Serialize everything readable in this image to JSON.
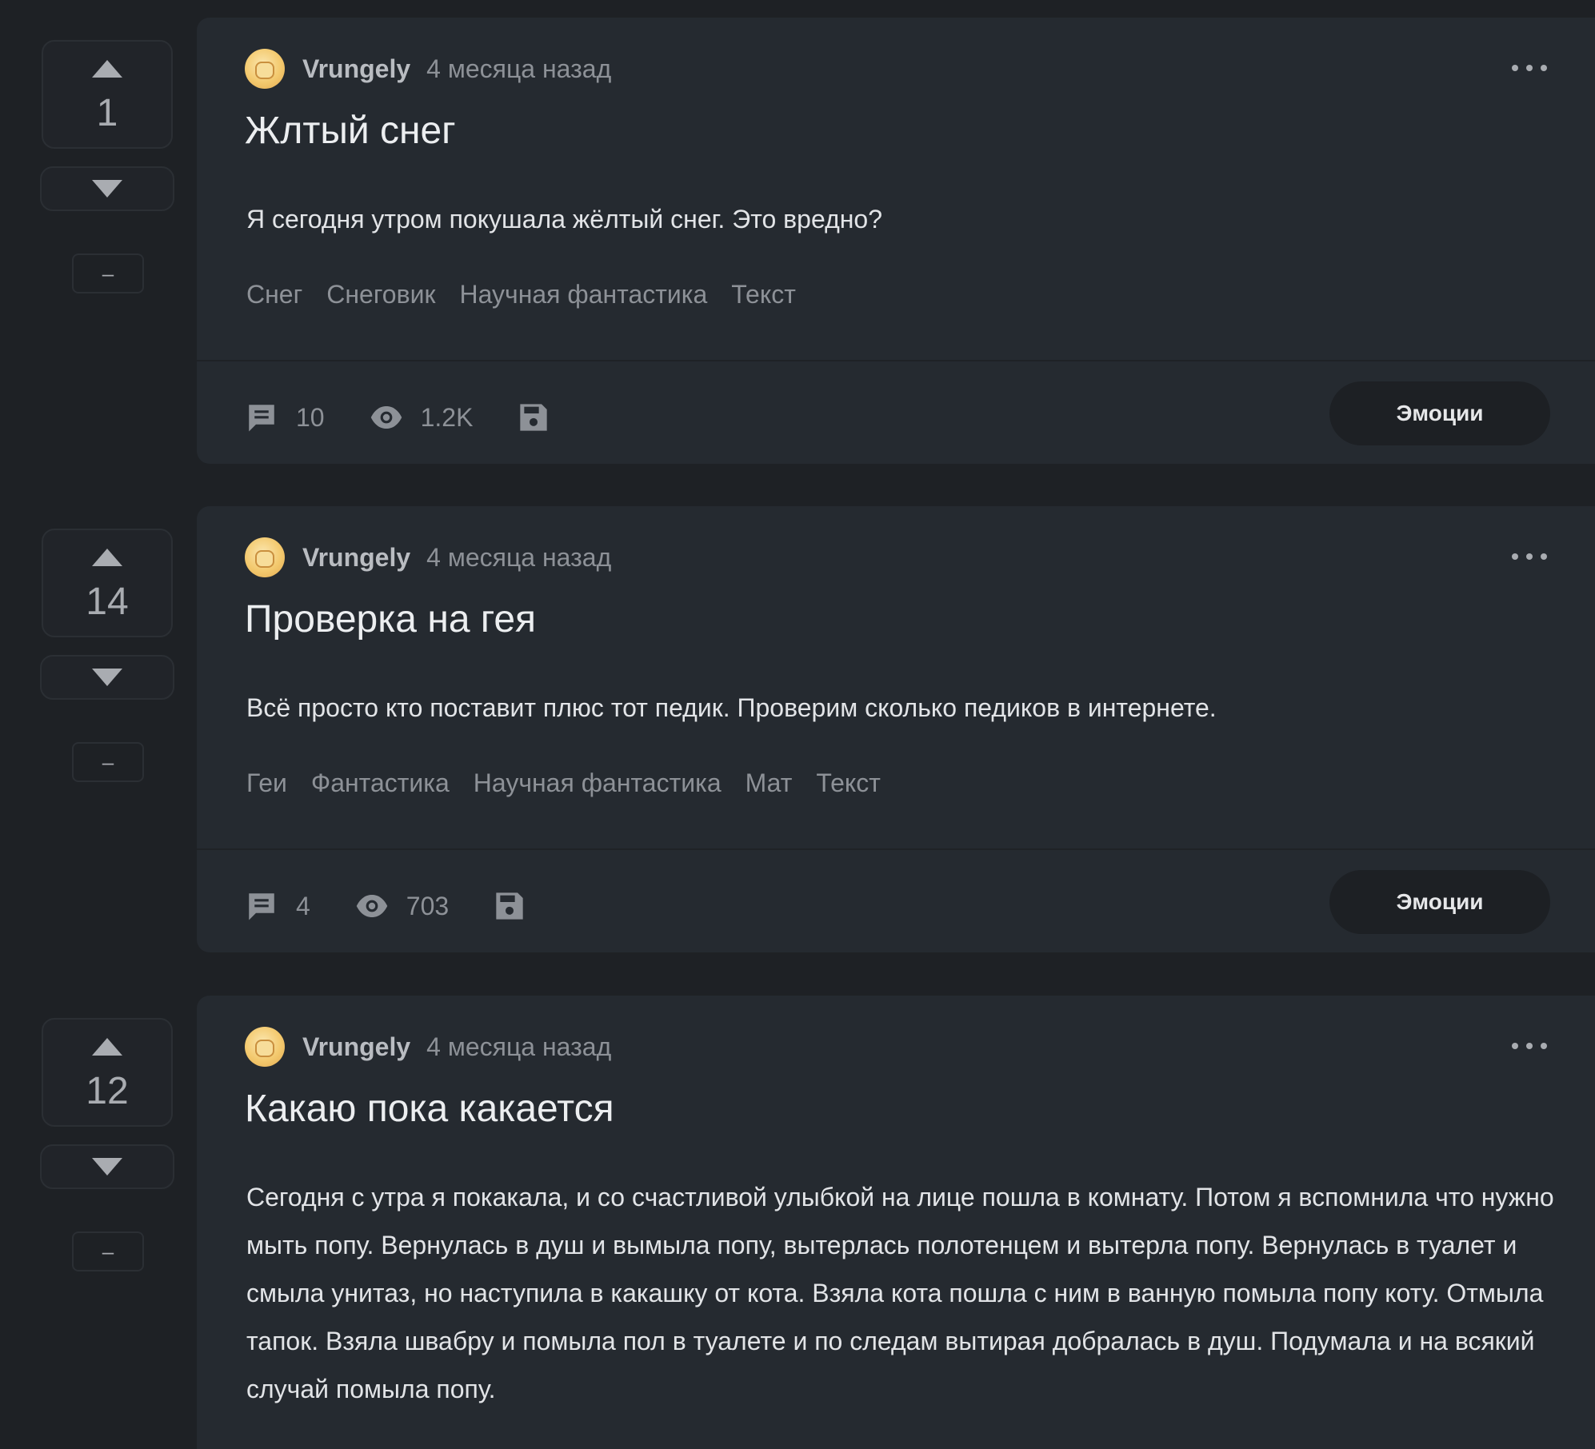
{
  "posts": [
    {
      "rating": "1",
      "author": "Vrungely",
      "time": "4 месяца назад",
      "title": "Жлтый снег",
      "body": "Я сегодня утром покушала жёлтый снег. Это вредно?",
      "tags": [
        "Снег",
        "Снеговик",
        "Научная фантастика",
        "Текст"
      ],
      "comments": "10",
      "views": "1.2K",
      "emotions_label": "Эмоции",
      "hide_label": "–"
    },
    {
      "rating": "14",
      "author": "Vrungely",
      "time": "4 месяца назад",
      "title": "Проверка на гея",
      "body": "Всё просто кто поставит плюс тот педик. Проверим сколько педиков в интернете.",
      "tags": [
        "Геи",
        "Фантастика",
        "Научная фантастика",
        "Мат",
        "Текст"
      ],
      "comments": "4",
      "views": "703",
      "emotions_label": "Эмоции",
      "hide_label": "–"
    },
    {
      "rating": "12",
      "author": "Vrungely",
      "time": "4 месяца назад",
      "title": "Какаю пока какается",
      "body": "Сегодня с утра я покакала, и со счастливой улыбкой на лице пошла в комнату. Потом я вспомнила что нужно мыть попу. Вернулась в душ и вымыла попу, вытерлась полотенцем и вытерла попу. Вернулась в туалет и смыла унитаз, но наступила в какашку от кота. Взяла кота пошла с ним в ванную помыла попу коту. Отмыла тапок. Взяла швабру и помыла пол в туалете и по следам вытирая добралась в душ. Подумала и на всякий случай помыла попу.",
      "hide_label": "–"
    }
  ],
  "icons": {
    "upvote": "triangle-up-icon",
    "downvote": "triangle-down-icon",
    "comments": "comment-icon",
    "views": "eye-icon",
    "save": "floppy-disk-icon",
    "more": "more-dots-icon"
  },
  "colors": {
    "background": "#1e2125",
    "card": "#252a30",
    "muted_text": "#8d9197",
    "icon": "#a9acb1"
  }
}
